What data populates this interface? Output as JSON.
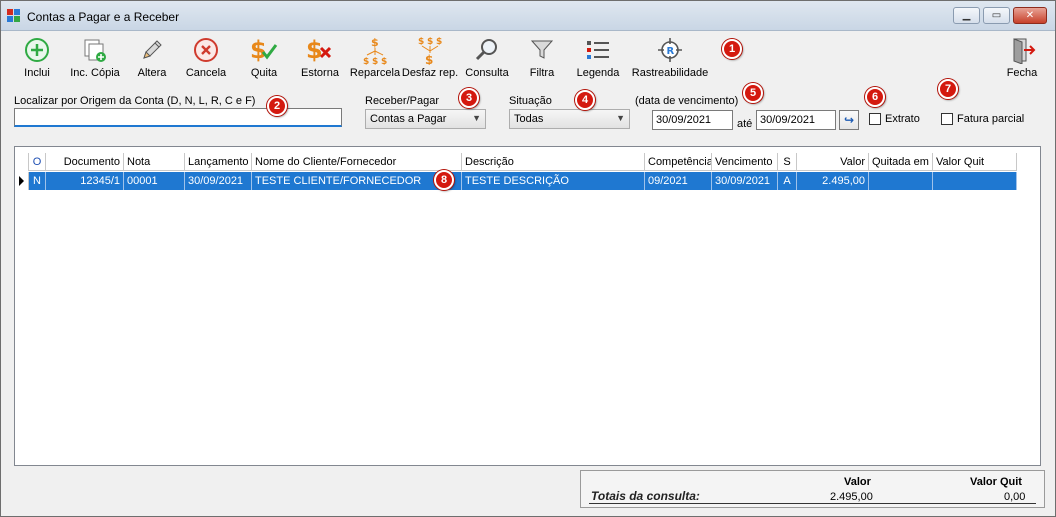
{
  "window": {
    "title": "Contas a Pagar e a Receber"
  },
  "toolbar": {
    "buttons": [
      {
        "label": "Inclui",
        "icon": "plus-circle-icon"
      },
      {
        "label": "Inc. Cópia",
        "icon": "copy-add-icon"
      },
      {
        "label": "Altera",
        "icon": "pencil-icon"
      },
      {
        "label": "Cancela",
        "icon": "cancel-circle-icon"
      },
      {
        "label": "Quita",
        "icon": "dollar-check-icon"
      },
      {
        "label": "Estorna",
        "icon": "dollar-x-icon"
      },
      {
        "label": "Reparcela",
        "icon": "dollar-split-icon"
      },
      {
        "label": "Desfaz rep.",
        "icon": "dollar-merge-icon"
      },
      {
        "label": "Consulta",
        "icon": "magnifier-icon"
      },
      {
        "label": "Filtra",
        "icon": "funnel-icon"
      },
      {
        "label": "Legenda",
        "icon": "legend-list-icon"
      },
      {
        "label": "Rastreabilidade",
        "icon": "target-r-icon"
      }
    ],
    "close_label": "Fecha"
  },
  "badges": [
    "1",
    "2",
    "3",
    "4",
    "5",
    "6",
    "7",
    "8"
  ],
  "filters": {
    "origin_label": "Localizar por Origem da Conta (D, N, L, R, C e F)",
    "origin_value": "",
    "receber_pagar_label": "Receber/Pagar",
    "receber_pagar_value": "Contas a Pagar",
    "situacao_label": "Situação",
    "situacao_value": "Todas",
    "vencimento_label": "(data de vencimento)",
    "date_from": "30/09/2021",
    "ate_label": "até",
    "date_to": "30/09/2021",
    "extrato_label": "Extrato",
    "fatura_label": "Fatura parcial"
  },
  "grid": {
    "columns": [
      "O",
      "Documento",
      "Nota",
      "Lançamento",
      "Nome do Cliente/Fornecedor",
      "Descrição",
      "Competência",
      "Vencimento",
      "S",
      "Valor",
      "Quitada em",
      "Valor Quit"
    ],
    "rows": [
      [
        "N",
        "12345/1",
        "00001",
        "30/09/2021",
        "TESTE CLIENTE/FORNECEDOR",
        "TESTE DESCRIÇÃO",
        "09/2021",
        "30/09/2021",
        "A",
        "2.495,00",
        "",
        ""
      ]
    ]
  },
  "totals": {
    "label": "Totais da consulta:",
    "valor_header": "Valor",
    "valor": "2.495,00",
    "valor_quit_header": "Valor Quit",
    "valor_quit": "0,00"
  },
  "colors": {
    "selection": "#1f78d1",
    "badge": "#d4190f",
    "accent_orange": "#e8881a",
    "accent_green": "#2faa43"
  }
}
